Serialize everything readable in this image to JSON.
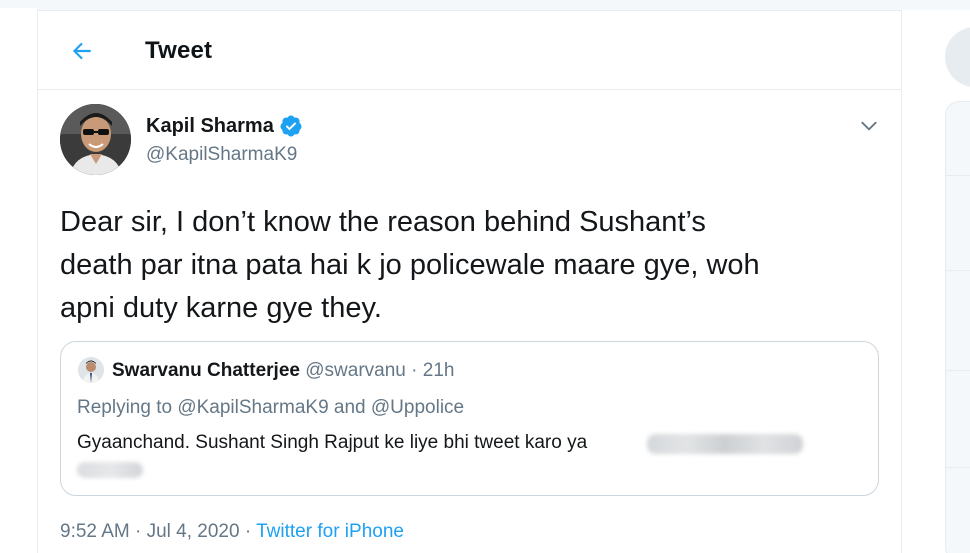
{
  "header": {
    "title": "Tweet"
  },
  "tweet": {
    "author_name": "Kapil Sharma",
    "author_handle": "@KapilSharmaK9",
    "text": "Dear sir, I don’t know the reason behind Sushant’s\ndeath par itna pata hai k jo policewale maare gye, woh\napni duty karne gye they.",
    "time": "9:52 AM",
    "separator": " · ",
    "date": "Jul 4, 2020",
    "source": "Twitter for iPhone"
  },
  "quoted_tweet": {
    "author_name": "Swarvanu Chatterjee",
    "author_handle": "@swarvanu",
    "age": "21h",
    "separator": " · ",
    "replying_to": "Replying to @KapilSharmaK9 and @Uppolice",
    "text": "Gyaanchand. Sushant Singh Rajput ke liye bhi tweet karo ya"
  },
  "icons": {
    "back": "back-arrow-icon",
    "verified": "verified-badge-icon",
    "caret": "chevron-down-icon"
  },
  "colors": {
    "accent": "#1da1f2",
    "secondary_text": "#657786",
    "border": "#e6ecf0"
  }
}
